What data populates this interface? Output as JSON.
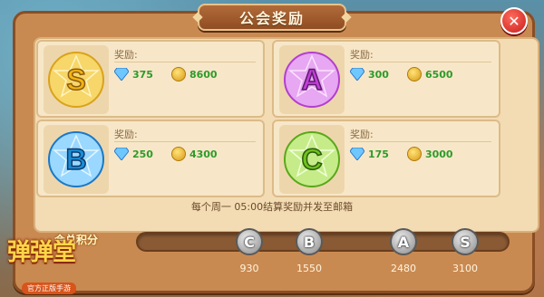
{
  "dialog": {
    "title": "公会奖励",
    "close_icon": "close-icon"
  },
  "tiers": [
    {
      "grade": "S",
      "reward_label": "奖励:",
      "gems": "375",
      "gold": "8600",
      "color": "#f2b512"
    },
    {
      "grade": "A",
      "reward_label": "奖励:",
      "gems": "300",
      "gold": "6500",
      "color": "#c23fd8"
    },
    {
      "grade": "B",
      "reward_label": "奖励:",
      "gems": "250",
      "gold": "4300",
      "color": "#1a8ed8"
    },
    {
      "grade": "C",
      "reward_label": "奖励:",
      "gems": "175",
      "gold": "3000",
      "color": "#6fc21e"
    }
  ],
  "note": "每个周一 05:00结算奖励并发至邮箱",
  "progress": {
    "label": "会总积分",
    "value_fraction": 0,
    "milestones": [
      {
        "grade": "C",
        "value": "930"
      },
      {
        "grade": "B",
        "value": "1550"
      },
      {
        "grade": "A",
        "value": "2480"
      },
      {
        "grade": "S",
        "value": "3100"
      }
    ]
  },
  "logo": {
    "name": "弹弹堂",
    "subtitle": "官方正版手游"
  }
}
